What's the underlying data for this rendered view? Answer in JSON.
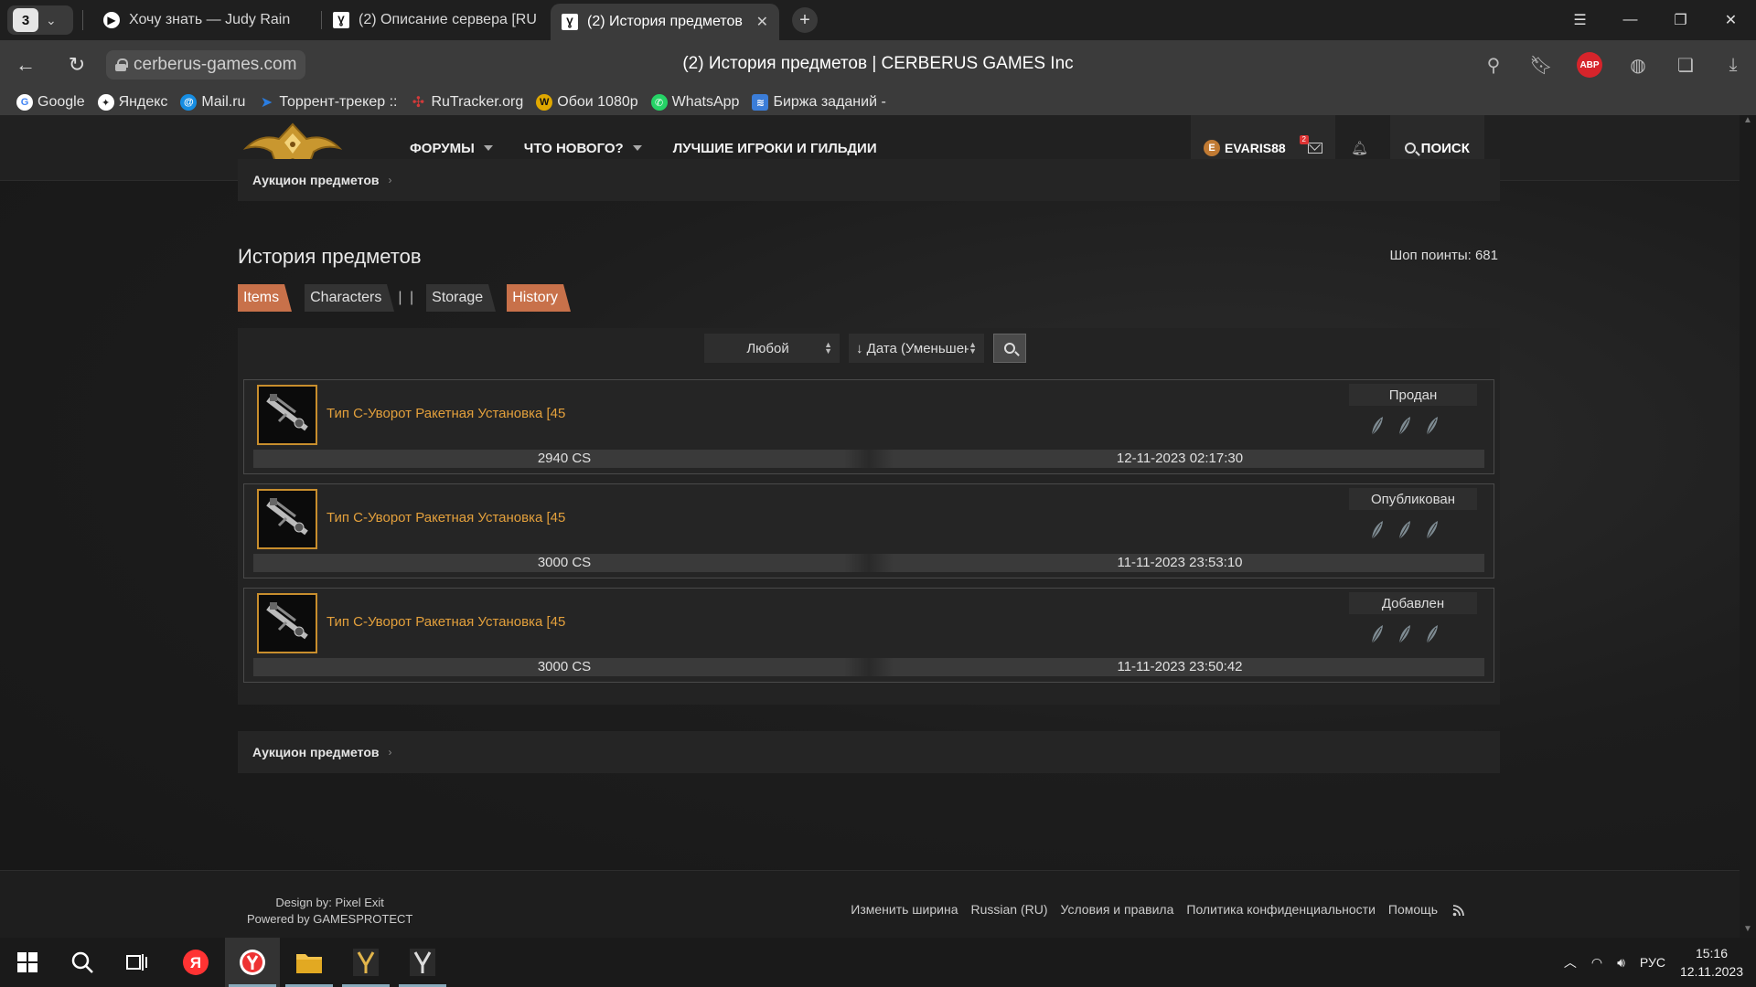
{
  "browser": {
    "tab_count": "3",
    "tabs": [
      {
        "title": "Хочу знать — Judy Rain",
        "active": false
      },
      {
        "title": "(2) Описание сервера [RU",
        "active": false
      },
      {
        "title": "(2) История предметов",
        "active": true
      }
    ],
    "url": "cerberus-games.com",
    "page_title": "(2) История предметов | CERBERUS GAMES Inc",
    "abp_label": "ABP",
    "bookmarks": [
      {
        "label": "Google",
        "icon": "google-icon",
        "color": "#4285f4"
      },
      {
        "label": "Яндекс",
        "icon": "yandex-star-icon",
        "color": "#222222"
      },
      {
        "label": "Mail.ru",
        "icon": "mailru-icon",
        "color": "#168de2"
      },
      {
        "label": "Торрент-трекер ::",
        "icon": "torrent-icon",
        "color": "#2a7de1"
      },
      {
        "label": "RuTracker.org",
        "icon": "rutracker-icon",
        "color": "#d23a3a"
      },
      {
        "label": "Обои 1080p",
        "icon": "wallpaper-icon",
        "color": "#e0a800"
      },
      {
        "label": "WhatsApp",
        "icon": "whatsapp-icon",
        "color": "#25d366"
      },
      {
        "label": "Биржа заданий - ",
        "icon": "task-exchange-icon",
        "color": "#3b7dd8"
      }
    ]
  },
  "site": {
    "nav": {
      "forums": "ФОРУМЫ",
      "whats_new": "ЧТО НОВОГО?",
      "top_players": "ЛУЧШИЕ ИГРОКИ И ГИЛЬДИИ"
    },
    "user": {
      "name": "EVARIS88",
      "avatar_letter": "E",
      "mail_badge": "2"
    },
    "search_label": "ПОИСК",
    "breadcrumb": "Аукцион предметов",
    "heading": "История предметов",
    "shop_points": "Шоп поинты: 681",
    "tabs": [
      {
        "label": "Items",
        "active": true
      },
      {
        "label": "Characters",
        "active": false
      },
      {
        "label": "Storage",
        "active": false
      },
      {
        "label": "History",
        "active": true
      }
    ],
    "tab_separator": "| |",
    "filters": {
      "type_value": "Любой",
      "sort_value": "↓ Дата (Уменьшен"
    },
    "items": [
      {
        "name": "Тип С-Уворот Ракетная Установка [45",
        "status": "Продан",
        "price": "2940 CS",
        "date": "12-11-2023 02:17:30"
      },
      {
        "name": "Тип С-Уворот Ракетная Установка [45",
        "status": "Опубликован",
        "price": "3000 CS",
        "date": "11-11-2023 23:53:10"
      },
      {
        "name": "Тип С-Уворот Ракетная Установка [45",
        "status": "Добавлен",
        "price": "3000 CS",
        "date": "11-11-2023 23:50:42"
      }
    ],
    "footer": {
      "design_by": "Design by: Pixel Exit",
      "powered_by": "Powered by GAMESPROTECT",
      "links": [
        "Изменить ширина",
        "Russian (RU)",
        "Условия и правила",
        "Политика конфиденциальности",
        "Помощь"
      ]
    }
  },
  "taskbar": {
    "lang": "РУС",
    "time": "15:16",
    "date": "12.11.2023"
  },
  "colors": {
    "accent_orange": "#c8714a",
    "item_name": "#e3a03c",
    "thumb_border": "#c88e2d"
  }
}
